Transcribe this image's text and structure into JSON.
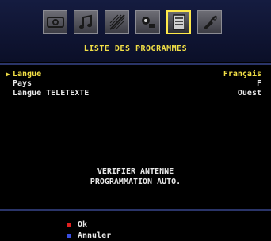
{
  "menu": {
    "title": "LISTE DES PROGRAMMES",
    "icons": [
      "picture-icon",
      "sound-icon",
      "settings-icon",
      "features-icon",
      "channel-list-icon",
      "source-icon"
    ],
    "active_icon_index": 4
  },
  "settings": [
    {
      "label": "Langue",
      "value": "Français",
      "selected": true
    },
    {
      "label": "Pays",
      "value": "F",
      "selected": false
    },
    {
      "label": "Langue TELETEXTE",
      "value": "Ouest",
      "selected": false
    }
  ],
  "actions": {
    "check_antenna": "VERIFIER ANTENNE",
    "auto_program": "PROGRAMMATION AUTO."
  },
  "legend": {
    "ok_label": "Ok",
    "cancel_label": "Annuler"
  },
  "colors": {
    "highlight": "#f2df46",
    "panel": "#0b0f28",
    "ok_dot": "#e02020",
    "cancel_dot": "#3a4ee0"
  }
}
